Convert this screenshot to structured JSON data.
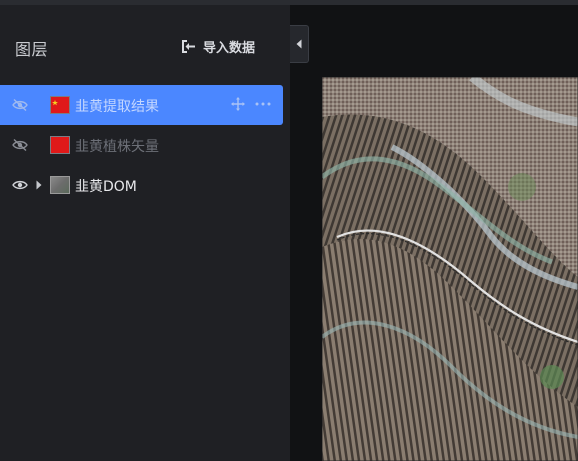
{
  "panel": {
    "title": "图层",
    "import_label": "导入数据",
    "layers": [
      {
        "name": "韭黄提取结果",
        "visible_icon": "eye-off-icon",
        "thumb": "flag-thumbnail",
        "state": "selected"
      },
      {
        "name": "韭黄植株矢量",
        "visible_icon": "eye-off-icon",
        "thumb": "red-fill-thumbnail",
        "state": "hidden"
      },
      {
        "name": "韭黄DOM",
        "visible_icon": "eye-icon",
        "thumb": "raster-thumbnail",
        "state": "visible"
      }
    ]
  },
  "colors": {
    "panel_bg": "#1f2024",
    "selected_row": "#4b87ff",
    "map_bg": "#111214",
    "vector_fill": "#e01919"
  },
  "icons": [
    "import-icon",
    "collapse-left-icon",
    "move-icon",
    "more-icon",
    "eye-icon",
    "eye-off-icon",
    "caret-right-icon"
  ]
}
